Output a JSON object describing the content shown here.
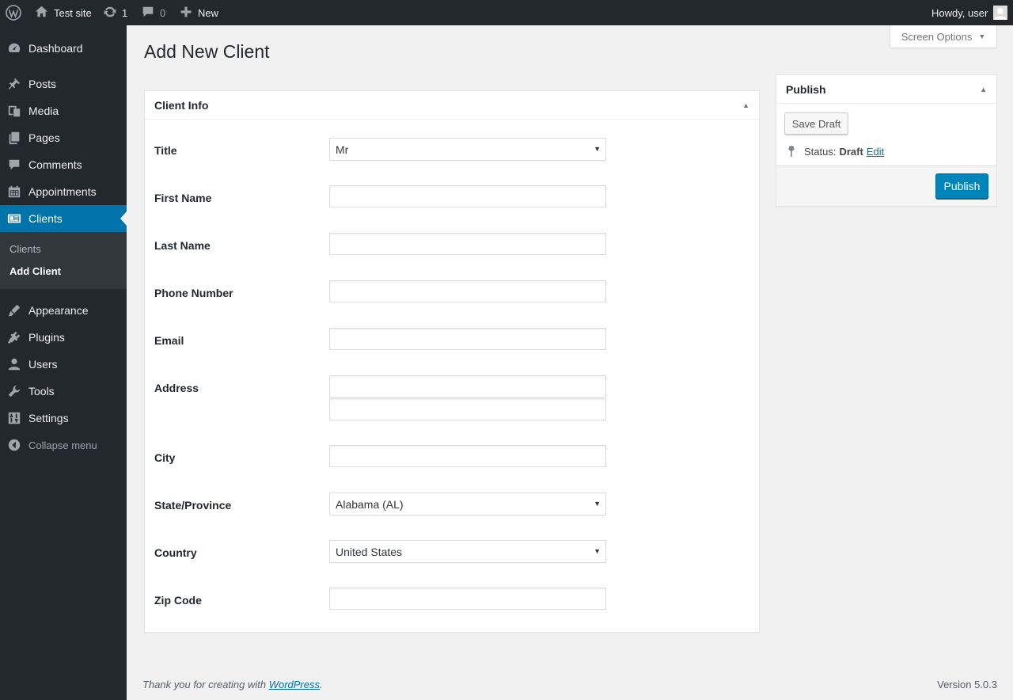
{
  "adminbar": {
    "site_name": "Test site",
    "updates_count": "1",
    "comments_count": "0",
    "new_label": "New",
    "howdy": "Howdy, user"
  },
  "sidebar": {
    "items": [
      {
        "label": "Dashboard",
        "icon": "dashboard-icon"
      },
      {
        "label": "Posts",
        "icon": "pin-icon"
      },
      {
        "label": "Media",
        "icon": "media-icon"
      },
      {
        "label": "Pages",
        "icon": "pages-icon"
      },
      {
        "label": "Comments",
        "icon": "comment-icon"
      },
      {
        "label": "Appointments",
        "icon": "calendar-icon"
      },
      {
        "label": "Clients",
        "icon": "id-card-icon"
      },
      {
        "label": "Appearance",
        "icon": "brush-icon"
      },
      {
        "label": "Plugins",
        "icon": "plug-icon"
      },
      {
        "label": "Users",
        "icon": "user-icon"
      },
      {
        "label": "Tools",
        "icon": "wrench-icon"
      },
      {
        "label": "Settings",
        "icon": "sliders-icon"
      }
    ],
    "submenu": [
      "Clients",
      "Add Client"
    ],
    "collapse_label": "Collapse menu"
  },
  "screen_options": "Screen Options",
  "page_title": "Add New Client",
  "client_info": {
    "heading": "Client Info",
    "fields": {
      "title": {
        "label": "Title",
        "value": "Mr"
      },
      "first_name": {
        "label": "First Name",
        "value": ""
      },
      "last_name": {
        "label": "Last Name",
        "value": ""
      },
      "phone": {
        "label": "Phone Number",
        "value": ""
      },
      "email": {
        "label": "Email",
        "value": ""
      },
      "address": {
        "label": "Address",
        "value1": "",
        "value2": ""
      },
      "city": {
        "label": "City",
        "value": ""
      },
      "state": {
        "label": "State/Province",
        "value": "Alabama (AL)"
      },
      "country": {
        "label": "Country",
        "value": "United States"
      },
      "zip": {
        "label": "Zip Code",
        "value": ""
      }
    }
  },
  "publish": {
    "heading": "Publish",
    "save_draft": "Save Draft",
    "status_label": "Status:",
    "status_value": "Draft",
    "edit_link": "Edit",
    "publish_button": "Publish"
  },
  "footer": {
    "thanks_prefix": "Thank you for creating with",
    "wordpress_link": "WordPress",
    "thanks_suffix": ".",
    "version": "Version 5.0.3"
  },
  "colors": {
    "admin_bar": "#23282d",
    "accent": "#0073aa",
    "primary_button": "#0085ba"
  }
}
